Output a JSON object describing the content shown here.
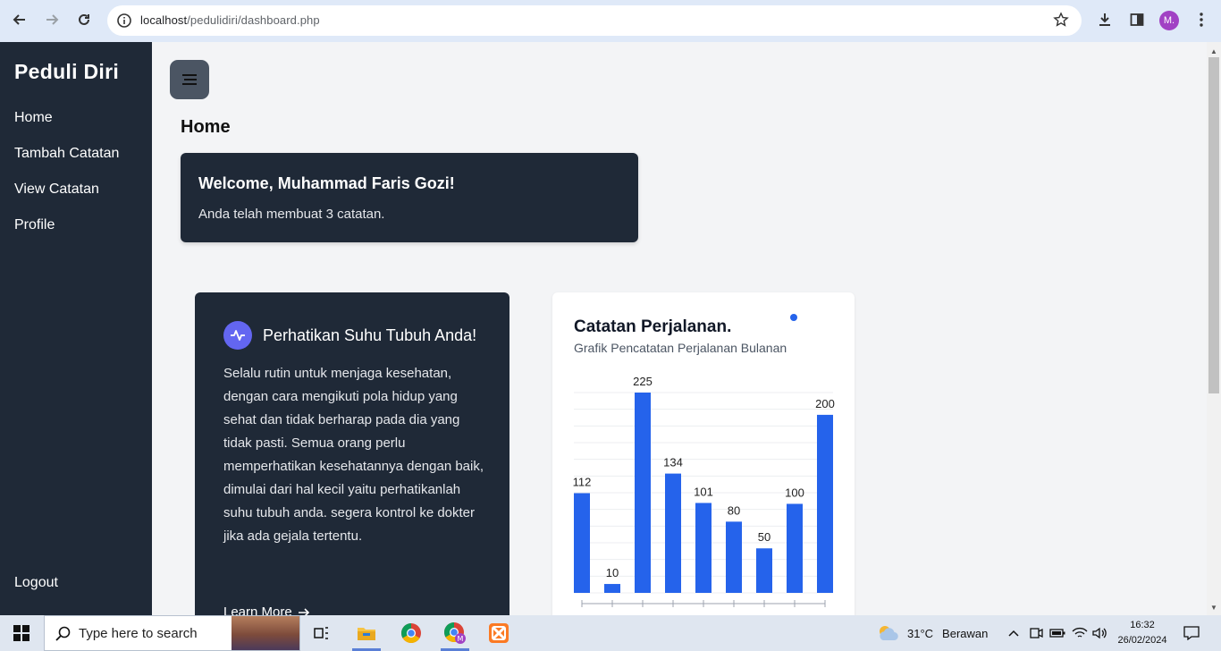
{
  "browser": {
    "url_host": "localhost",
    "url_path": "/pedulidiri/dashboard.php",
    "profile_initial": "M."
  },
  "sidebar": {
    "brand": "Peduli Diri",
    "items": [
      {
        "label": "Home"
      },
      {
        "label": "Tambah Catatan"
      },
      {
        "label": "View Catatan"
      },
      {
        "label": "Profile"
      }
    ],
    "logout": "Logout"
  },
  "main": {
    "title": "Home",
    "welcome_title": "Welcome, Muhammad Faris Gozi!",
    "welcome_text": "Anda telah membuat 3 catatan."
  },
  "health_card": {
    "title": "Perhatikan Suhu Tubuh Anda!",
    "body": "Selalu rutin untuk menjaga kesehatan, dengan cara mengikuti pola hidup yang sehat dan tidak berharap pada dia yang tidak pasti. Semua orang perlu memperhatikan kesehatannya dengan baik, dimulai dari hal kecil yaitu perhatikanlah suhu tubuh anda. segera kontrol ke dokter jika ada gejala tertentu.",
    "link": "Learn More"
  },
  "chart_card": {
    "title": "Catatan Perjalanan.",
    "subtitle": "Grafik Pencatatan Perjalanan Bulanan"
  },
  "chart_data": {
    "type": "bar",
    "title": "Catatan Perjalanan.",
    "subtitle": "Grafik Pencatatan Perjalanan Bulanan",
    "values": [
      112,
      10,
      225,
      134,
      101,
      80,
      50,
      100,
      200
    ],
    "ylim": [
      0,
      225
    ],
    "grid": true,
    "color": "#2563eb"
  },
  "taskbar": {
    "search_placeholder": "Type here to search",
    "weather_temp": "31°C",
    "weather_text": "Berawan",
    "time": "16:32",
    "date": "26/02/2024"
  },
  "colors": {
    "sidebar": "#1f2937",
    "accent": "#2563eb",
    "icon_circle": "#6366f1"
  }
}
